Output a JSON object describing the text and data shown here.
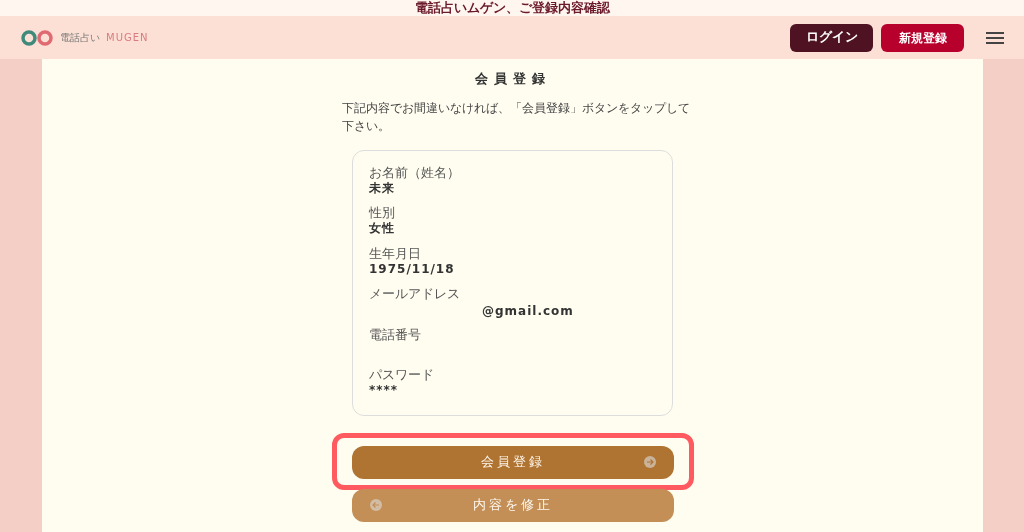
{
  "banner": {
    "text": "電話占いムゲン、ご登録内容確認"
  },
  "header": {
    "logo_small": "電話占い",
    "logo_text": "MUGEN",
    "login_button": "ログイン",
    "signup_button": "新規登録"
  },
  "page": {
    "title": "会員登録",
    "description": "下記内容でお間違いなければ、「会員登録」ボタンをタップして下さい。"
  },
  "fields": [
    {
      "label": "お名前（姓名）",
      "value": "未来"
    },
    {
      "label": "性別",
      "value": "女性"
    },
    {
      "label": "生年月日",
      "value": "1975/11/18"
    },
    {
      "label": "メールアドレス",
      "value": "@gmail.com",
      "kind": "masked"
    },
    {
      "label": "電話番号"
    },
    {
      "label": "パスワード",
      "value": "****"
    }
  ],
  "buttons": [
    {
      "label": "会員登録",
      "kind": "submit",
      "highlighted": true
    },
    {
      "label": "内容を修正",
      "kind": "back",
      "highlighted": false
    }
  ]
}
